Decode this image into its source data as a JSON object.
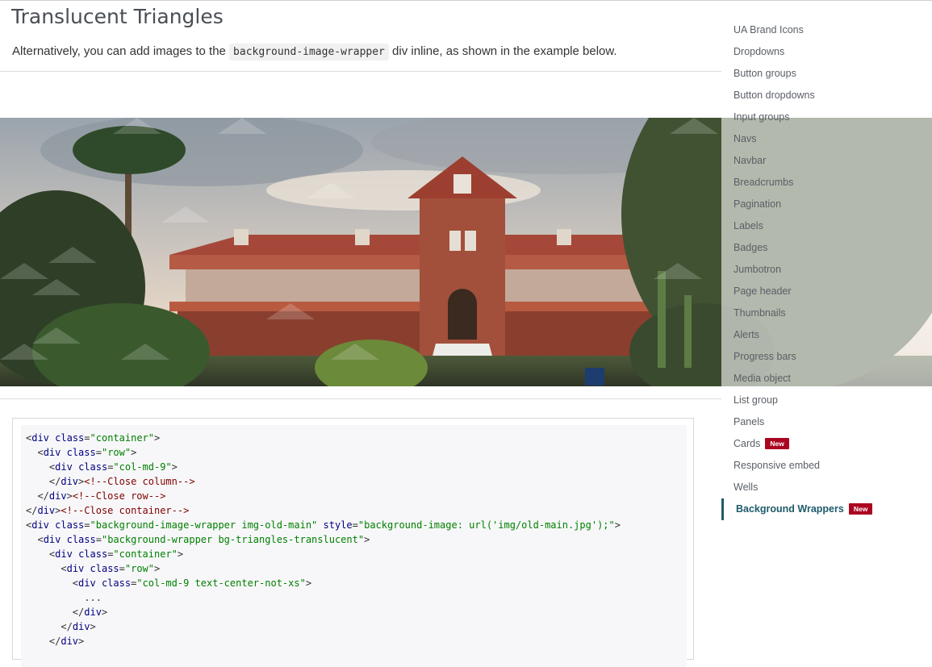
{
  "page": {
    "heading": "Translucent Triangles",
    "intro_before": "Alternatively, you can add images to the ",
    "intro_code": "background-image-wrapper",
    "intro_after": " div inline, as shown in the example below."
  },
  "colors": {
    "accent": "#1e5b6b",
    "badge": "#ab0520"
  },
  "sidebar": {
    "items": [
      {
        "label": "UA Brand Icons"
      },
      {
        "label": "Dropdowns"
      },
      {
        "label": "Button groups"
      },
      {
        "label": "Button dropdowns"
      },
      {
        "label": "Input groups"
      },
      {
        "label": "Navs"
      },
      {
        "label": "Navbar"
      },
      {
        "label": "Breadcrumbs"
      },
      {
        "label": "Pagination"
      },
      {
        "label": "Labels"
      },
      {
        "label": "Badges"
      },
      {
        "label": "Jumbotron"
      },
      {
        "label": "Page header"
      },
      {
        "label": "Thumbnails"
      },
      {
        "label": "Alerts"
      },
      {
        "label": "Progress bars"
      },
      {
        "label": "Media object"
      },
      {
        "label": "List group"
      },
      {
        "label": "Panels"
      },
      {
        "label": "Cards",
        "badge": "New"
      },
      {
        "label": "Responsive embed"
      },
      {
        "label": "Wells"
      },
      {
        "label": "Background Wrappers",
        "badge": "New",
        "active": true
      }
    ]
  },
  "code": {
    "lines": [
      {
        "indent": "",
        "parts": [
          [
            "p",
            "<"
          ],
          [
            "t",
            "div"
          ],
          [
            "p",
            " "
          ],
          [
            "a",
            "class"
          ],
          [
            "p",
            "="
          ],
          [
            "v",
            "\"container\""
          ],
          [
            "p",
            ">"
          ]
        ]
      },
      {
        "indent": "  ",
        "parts": [
          [
            "p",
            "<"
          ],
          [
            "t",
            "div"
          ],
          [
            "p",
            " "
          ],
          [
            "a",
            "class"
          ],
          [
            "p",
            "="
          ],
          [
            "v",
            "\"row\""
          ],
          [
            "p",
            ">"
          ]
        ]
      },
      {
        "indent": "    ",
        "parts": [
          [
            "p",
            "<"
          ],
          [
            "t",
            "div"
          ],
          [
            "p",
            " "
          ],
          [
            "a",
            "class"
          ],
          [
            "p",
            "="
          ],
          [
            "v",
            "\"col-md-9\""
          ],
          [
            "p",
            ">"
          ]
        ]
      },
      {
        "indent": "    ",
        "parts": [
          [
            "p",
            "</"
          ],
          [
            "t",
            "div"
          ],
          [
            "p",
            ">"
          ],
          [
            "c",
            "<!--Close column-->"
          ]
        ]
      },
      {
        "indent": "  ",
        "parts": [
          [
            "p",
            "</"
          ],
          [
            "t",
            "div"
          ],
          [
            "p",
            ">"
          ],
          [
            "c",
            "<!--Close row-->"
          ]
        ]
      },
      {
        "indent": "",
        "parts": [
          [
            "p",
            "</"
          ],
          [
            "t",
            "div"
          ],
          [
            "p",
            ">"
          ],
          [
            "c",
            "<!--Close container-->"
          ]
        ]
      },
      {
        "indent": "",
        "parts": [
          [
            "p",
            "<"
          ],
          [
            "t",
            "div"
          ],
          [
            "p",
            " "
          ],
          [
            "a",
            "class"
          ],
          [
            "p",
            "="
          ],
          [
            "v",
            "\"background-image-wrapper img-old-main\""
          ],
          [
            "p",
            " "
          ],
          [
            "a",
            "style"
          ],
          [
            "p",
            "="
          ],
          [
            "v",
            "\"background-image: url('img/old-main.jpg');\""
          ],
          [
            "p",
            ">"
          ]
        ]
      },
      {
        "indent": "  ",
        "parts": [
          [
            "p",
            "<"
          ],
          [
            "t",
            "div"
          ],
          [
            "p",
            " "
          ],
          [
            "a",
            "class"
          ],
          [
            "p",
            "="
          ],
          [
            "v",
            "\"background-wrapper bg-triangles-translucent\""
          ],
          [
            "p",
            ">"
          ]
        ]
      },
      {
        "indent": "    ",
        "parts": [
          [
            "p",
            "<"
          ],
          [
            "t",
            "div"
          ],
          [
            "p",
            " "
          ],
          [
            "a",
            "class"
          ],
          [
            "p",
            "="
          ],
          [
            "v",
            "\"container\""
          ],
          [
            "p",
            ">"
          ]
        ]
      },
      {
        "indent": "      ",
        "parts": [
          [
            "p",
            "<"
          ],
          [
            "t",
            "div"
          ],
          [
            "p",
            " "
          ],
          [
            "a",
            "class"
          ],
          [
            "p",
            "="
          ],
          [
            "v",
            "\"row\""
          ],
          [
            "p",
            ">"
          ]
        ]
      },
      {
        "indent": "        ",
        "parts": [
          [
            "p",
            "<"
          ],
          [
            "t",
            "div"
          ],
          [
            "p",
            " "
          ],
          [
            "a",
            "class"
          ],
          [
            "p",
            "="
          ],
          [
            "v",
            "\"col-md-9 text-center-not-xs\""
          ],
          [
            "p",
            ">"
          ]
        ]
      },
      {
        "indent": "          ",
        "parts": [
          [
            "p",
            "..."
          ]
        ]
      },
      {
        "indent": "        ",
        "parts": [
          [
            "p",
            "</"
          ],
          [
            "t",
            "div"
          ],
          [
            "p",
            ">"
          ]
        ]
      },
      {
        "indent": "      ",
        "parts": [
          [
            "p",
            "</"
          ],
          [
            "t",
            "div"
          ],
          [
            "p",
            ">"
          ]
        ]
      },
      {
        "indent": "    ",
        "parts": [
          [
            "p",
            "</"
          ],
          [
            "t",
            "div"
          ],
          [
            "p",
            ">"
          ]
        ]
      }
    ]
  }
}
